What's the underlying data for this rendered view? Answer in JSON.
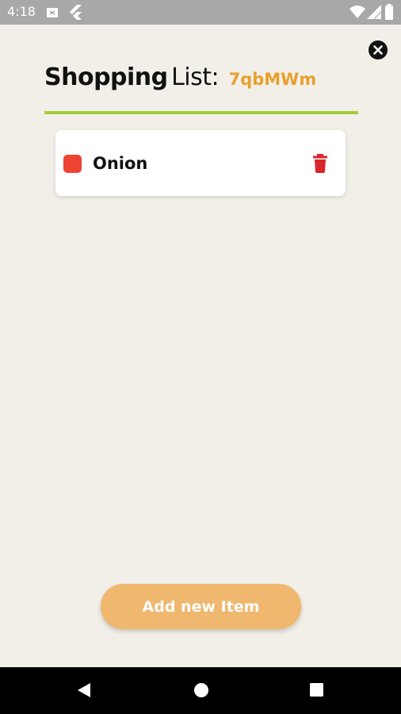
{
  "status_bar": {
    "time": "4:18",
    "left_icons": [
      "screenshot-icon",
      "flutter-icon"
    ],
    "right_icons": [
      "wifi-icon",
      "signal-icon",
      "battery-icon"
    ]
  },
  "header": {
    "title_bold": "Shopping",
    "title_rest": "List:",
    "list_code": "7qbMWm",
    "divider_color": "#a6cc36",
    "close_icon": "close-circle-icon"
  },
  "items": [
    {
      "name": "Onion",
      "checkbox_color": "#ee4433",
      "delete_icon": "trash-icon"
    }
  ],
  "footer": {
    "add_button_label": "Add new Item",
    "button_color": "#f0b76e"
  },
  "nav_bar": {
    "buttons": [
      "back-icon",
      "home-icon",
      "recents-icon"
    ]
  },
  "colors": {
    "background": "#f2efe8",
    "accent_code": "#e8a02c",
    "delete_red": "#d9262a"
  }
}
